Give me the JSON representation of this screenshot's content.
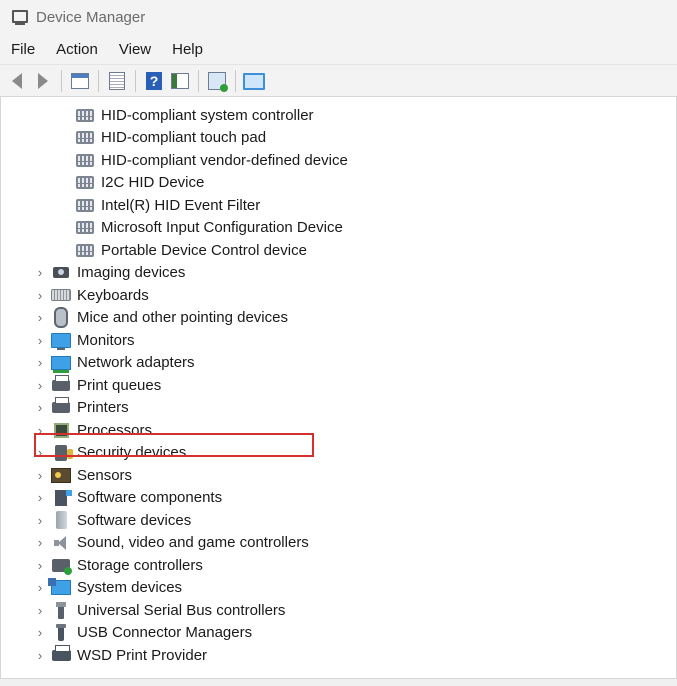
{
  "window": {
    "title": "Device Manager"
  },
  "menu": [
    "File",
    "Action",
    "View",
    "Help"
  ],
  "toolbar": [
    {
      "name": "back-button",
      "icon": "back-arrow-icon"
    },
    {
      "name": "forward-button",
      "icon": "forward-arrow-icon"
    },
    {
      "name": "show-hide-console-tree-button",
      "icon": "console-tree-icon"
    },
    {
      "name": "properties-button",
      "icon": "properties-icon"
    },
    {
      "name": "help-button",
      "icon": "help-icon",
      "glyph": "?"
    },
    {
      "name": "action-pane-button",
      "icon": "action-pane-icon"
    },
    {
      "name": "scan-hardware-button",
      "icon": "scan-hardware-icon"
    },
    {
      "name": "monitor-button",
      "icon": "monitor-icon"
    }
  ],
  "tree": {
    "children": [
      "HID-compliant system controller",
      "HID-compliant touch pad",
      "HID-compliant vendor-defined device",
      "I2C HID Device",
      "Intel(R) HID Event Filter",
      "Microsoft Input Configuration Device",
      "Portable Device Control device"
    ],
    "categories": [
      {
        "label": "Imaging devices",
        "icon": "cam"
      },
      {
        "label": "Keyboards",
        "icon": "kbd"
      },
      {
        "label": "Mice and other pointing devices",
        "icon": "mouse"
      },
      {
        "label": "Monitors",
        "icon": "mon"
      },
      {
        "label": "Network adapters",
        "icon": "net"
      },
      {
        "label": "Print queues",
        "icon": "print"
      },
      {
        "label": "Printers",
        "icon": "print"
      },
      {
        "label": "Processors",
        "icon": "cpu"
      },
      {
        "label": "Security devices",
        "icon": "sec"
      },
      {
        "label": "Sensors",
        "icon": "sens"
      },
      {
        "label": "Software components",
        "icon": "swc"
      },
      {
        "label": "Software devices",
        "icon": "swd"
      },
      {
        "label": "Sound, video and game controllers",
        "icon": "snd"
      },
      {
        "label": "Storage controllers",
        "icon": "stor"
      },
      {
        "label": "System devices",
        "icon": "sys"
      },
      {
        "label": "Universal Serial Bus controllers",
        "icon": "usb"
      },
      {
        "label": "USB Connector Managers",
        "icon": "usbc"
      },
      {
        "label": "WSD Print Provider",
        "icon": "wsd"
      }
    ],
    "chevron_glyph": "›",
    "highlight_color": "#d43030"
  }
}
